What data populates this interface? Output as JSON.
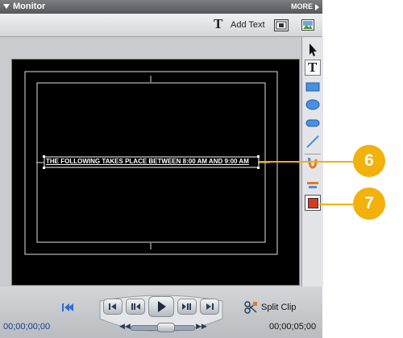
{
  "panel": {
    "title": "Monitor",
    "more_label": "MORE"
  },
  "toolbar": {
    "add_text_label": "Add Text"
  },
  "preview": {
    "text_line": "THE FOLLOWING TAKES PLACE BETWEEN 8:00 AM AND 9:00 AM"
  },
  "transport": {
    "current_time": "00;00;00;00",
    "duration": "00;00;05;00",
    "split_clip_label": "Split Clip",
    "jog_position": 0.55
  },
  "callouts": [
    "6",
    "7"
  ],
  "colors": {
    "callout": "#f2b10b",
    "timecode": "#1a3f8c",
    "viewer_bg": "#000000"
  }
}
